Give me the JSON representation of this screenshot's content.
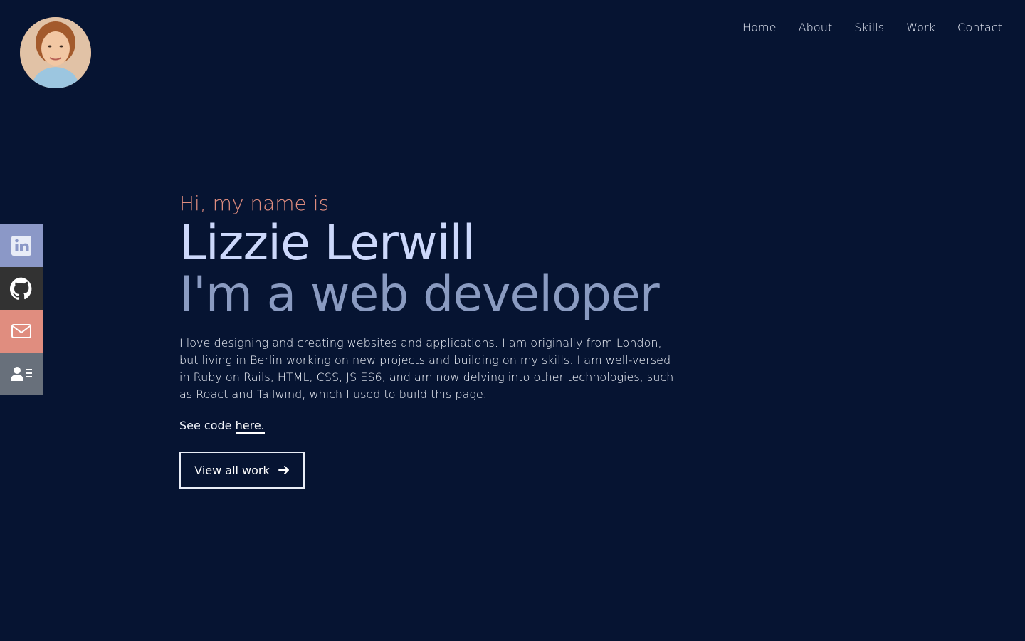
{
  "nav": {
    "items": [
      "Home",
      "About",
      "Skills",
      "Work",
      "Contact"
    ]
  },
  "hero": {
    "greeting": "Hi, my name is",
    "name": "Lizzie Lerwill",
    "role": "I'm a web developer",
    "bio": "I love designing and creating websites and applications. I am originally from London, but living in Berlin working on new projects and building on my skills. I am well-versed in Ruby on Rails, HTML, CSS, JS ES6, and am now delving into other technologies, such as React and Tailwind, which I used to build this page.",
    "code_prefix": "See code",
    "code_link": "here.",
    "button_label": "View all work"
  },
  "social": [
    {
      "name": "linkedin-icon",
      "color": "#8b98c7"
    },
    {
      "name": "github-icon",
      "color": "#323232"
    },
    {
      "name": "mail-icon",
      "color": "#e08d7f"
    },
    {
      "name": "contact-card-icon",
      "color": "#68707b"
    }
  ],
  "colors": {
    "background": "#061432",
    "accent": "#e08d7f",
    "name": "#ccd8fb",
    "role": "#8a9bc1"
  }
}
